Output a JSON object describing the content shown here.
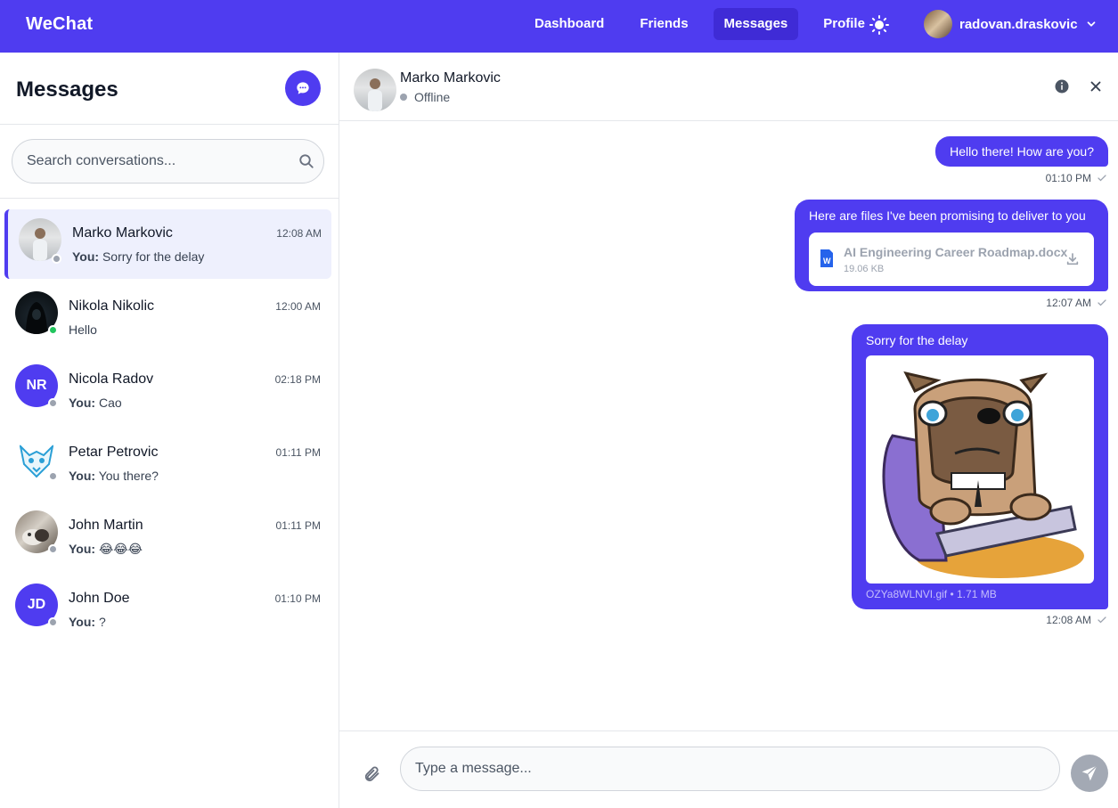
{
  "app": {
    "brand": "WeChat"
  },
  "nav": {
    "items": [
      {
        "label": "Dashboard",
        "active": false
      },
      {
        "label": "Friends",
        "active": false
      },
      {
        "label": "Messages",
        "active": true
      },
      {
        "label": "Profile",
        "active": false
      }
    ],
    "theme_icon": "sun-icon",
    "user": {
      "name": "radovan.draskovic",
      "menu_icon": "chevron-down-icon"
    }
  },
  "sidebar": {
    "title": "Messages",
    "new_chat_icon": "chat-bubble-icon",
    "search": {
      "placeholder": "Search conversations...",
      "value": ""
    },
    "conversations": [
      {
        "name": "Marko Markovic",
        "time": "12:08 AM",
        "you_prefix": "You:",
        "preview": "Sorry for the delay",
        "status": "offline",
        "active": true,
        "initials": ""
      },
      {
        "name": "Nikola Nikolic",
        "time": "12:00 AM",
        "you_prefix": "",
        "preview": "Hello",
        "status": "online",
        "active": false,
        "initials": ""
      },
      {
        "name": "Nicola Radov",
        "time": "02:18 PM",
        "you_prefix": "You:",
        "preview": "Cao",
        "status": "offline",
        "active": false,
        "initials": "NR"
      },
      {
        "name": "Petar Petrovic",
        "time": "01:11 PM",
        "you_prefix": "You:",
        "preview": "You there?",
        "status": "offline",
        "active": false,
        "initials": ""
      },
      {
        "name": "John Martin",
        "time": "01:11 PM",
        "you_prefix": "You:",
        "preview": "😂😂😂",
        "status": "offline",
        "active": false,
        "initials": ""
      },
      {
        "name": "John Doe",
        "time": "01:10 PM",
        "you_prefix": "You:",
        "preview": "?",
        "status": "offline",
        "active": false,
        "initials": "JD"
      }
    ]
  },
  "chat": {
    "contact_name": "Marko Markovic",
    "contact_status": "Offline",
    "info_icon": "info-icon",
    "close_icon": "close-icon",
    "messages": [
      {
        "text": "Hello there! How are you?",
        "time": "01:10 PM"
      },
      {
        "text": "Here are files I've been promising to deliver to you",
        "time": "12:07 AM",
        "file": {
          "name": "AI Engineering Career Roadmap.docx",
          "size": "19.06 KB",
          "icon": "word-document-icon"
        }
      },
      {
        "text": "Sorry for the delay",
        "time": "12:08 AM",
        "image": {
          "caption": "OZYa8WLNVI.gif • 1.71 MB"
        }
      }
    ],
    "composer": {
      "placeholder": "Type a message...",
      "value": "",
      "attach_icon": "paperclip-icon",
      "send_icon": "send-icon"
    }
  },
  "colors": {
    "accent": "#4f3cf0",
    "accent_dark": "#3f2bd6",
    "online": "#22c55e",
    "offline": "#9ca3af"
  }
}
